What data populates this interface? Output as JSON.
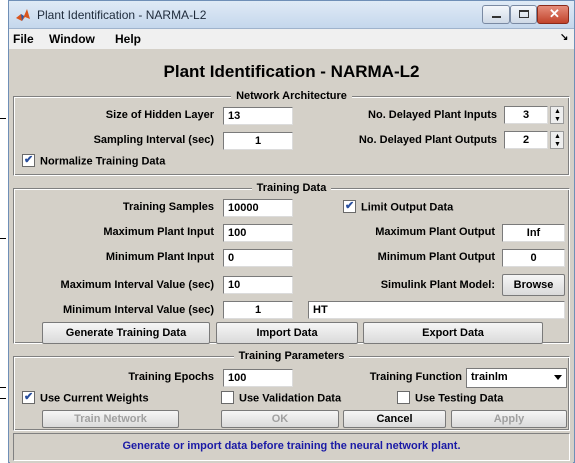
{
  "window": {
    "title": "Plant Identification - NARMA-L2",
    "icon": "matlab-icon"
  },
  "menu": {
    "items": [
      "File",
      "Window",
      "Help"
    ],
    "corner": "↘"
  },
  "heading": "Plant Identification - NARMA-L2",
  "network_architecture": {
    "title": "Network Architecture",
    "hidden_layer_label": "Size of Hidden Layer",
    "hidden_layer_value": "13",
    "sampling_label": "Sampling Interval (sec)",
    "sampling_value": "1",
    "delayed_inputs_label": "No. Delayed Plant Inputs",
    "delayed_inputs_value": "3",
    "delayed_outputs_label": "No. Delayed Plant Outputs",
    "delayed_outputs_value": "2",
    "normalize_label": "Normalize Training Data",
    "normalize_checked": true
  },
  "training_data": {
    "title": "Training Data",
    "samples_label": "Training Samples",
    "samples_value": "10000",
    "max_input_label": "Maximum Plant Input",
    "max_input_value": "100",
    "min_input_label": "Minimum Plant Input",
    "min_input_value": "0",
    "max_interval_label": "Maximum Interval Value (sec)",
    "max_interval_value": "10",
    "min_interval_label": "Minimum Interval Value (sec)",
    "min_interval_value": "1",
    "limit_output_label": "Limit Output Data",
    "limit_output_checked": true,
    "max_output_label": "Maximum Plant Output",
    "max_output_value": "Inf",
    "min_output_label": "Minimum Plant Output",
    "min_output_value": "0",
    "simulink_label": "Simulink Plant Model:",
    "browse_label": "Browse",
    "model_value": "HT",
    "generate_label": "Generate Training Data",
    "import_label": "Import Data",
    "export_label": "Export Data"
  },
  "training_parameters": {
    "title": "Training Parameters",
    "epochs_label": "Training Epochs",
    "epochs_value": "100",
    "function_label": "Training Function",
    "function_value": "trainlm",
    "use_current_weights_label": "Use Current Weights",
    "use_current_weights_checked": true,
    "use_validation_label": "Use Validation Data",
    "use_validation_checked": false,
    "use_testing_label": "Use Testing Data",
    "use_testing_checked": false
  },
  "actions": {
    "train_label": "Train Network",
    "ok_label": "OK",
    "cancel_label": "Cancel",
    "apply_label": "Apply"
  },
  "status_message": "Generate or import data before training the neural network plant."
}
